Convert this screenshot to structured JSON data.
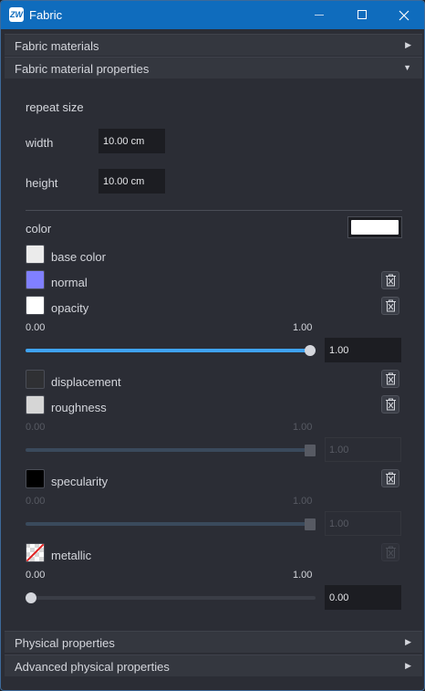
{
  "window": {
    "title": "Fabric",
    "app_icon_text": "ZW"
  },
  "sections": {
    "fabric_materials": "Fabric materials",
    "fabric_material_properties": "Fabric material properties",
    "physical_properties": "Physical properties",
    "advanced_physical_properties": "Advanced physical properties"
  },
  "repeat_size": {
    "heading": "repeat size",
    "width_label": "width",
    "width_value": "10.00 cm",
    "height_label": "height",
    "height_value": "10.00 cm"
  },
  "color": {
    "label": "color",
    "value": "#ffffff"
  },
  "maps": {
    "base_color": {
      "label": "base color",
      "swatch": "#ebebeb"
    },
    "normal": {
      "label": "normal",
      "swatch": "#8080ff"
    },
    "opacity": {
      "label": "opacity",
      "swatch": "#ffffff",
      "min": "0.00",
      "max": "1.00",
      "value": "1.00",
      "fraction": 1.0
    },
    "displacement": {
      "label": "displacement",
      "swatch": "#2f3033"
    },
    "roughness": {
      "label": "roughness",
      "swatch": "#d6d6d6",
      "min": "0.00",
      "max": "1.00",
      "value": "1.00",
      "fraction": 1.0
    },
    "specularity": {
      "label": "specularity",
      "swatch": "#000000",
      "min": "0.00",
      "max": "1.00",
      "value": "1.00",
      "fraction": 1.0
    },
    "metallic": {
      "label": "metallic",
      "min": "0.00",
      "max": "1.00",
      "value": "0.00",
      "fraction": 0.0
    }
  },
  "colors": {
    "titlebar": "#0f6cbd",
    "accent_slider": "#3fa3f5",
    "panel": "#2b2d35"
  }
}
